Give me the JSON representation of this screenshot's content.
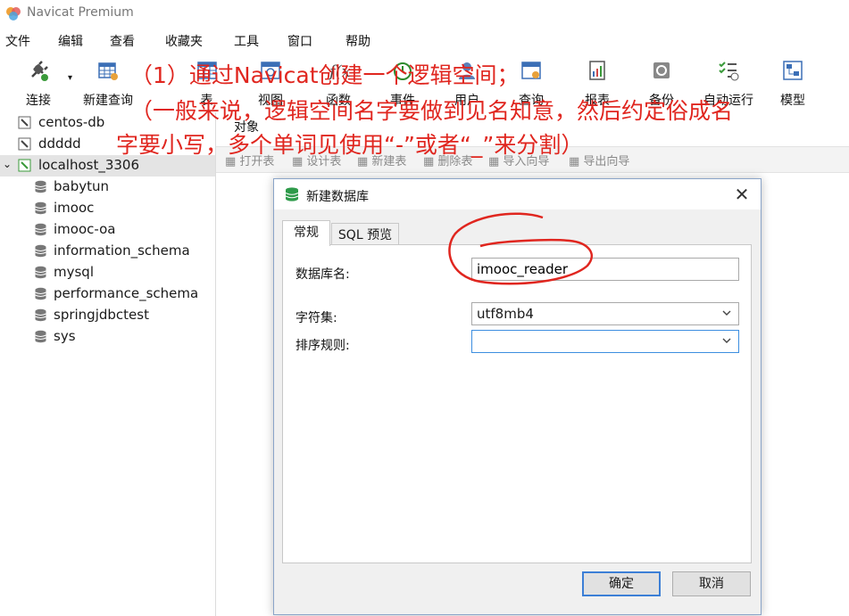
{
  "window": {
    "title": "Navicat Premium"
  },
  "menu": [
    "文件",
    "编辑",
    "查看",
    "收藏夹",
    "工具",
    "窗口",
    "帮助"
  ],
  "toolbar": {
    "items": [
      {
        "label": "连接",
        "icon": "plug-icon"
      },
      {
        "label": "新建查询",
        "icon": "table-query-icon"
      },
      {
        "label": "表",
        "icon": "table-icon"
      },
      {
        "label": "视图",
        "icon": "view-icon"
      },
      {
        "label": "函数",
        "icon": "function-icon"
      },
      {
        "label": "事件",
        "icon": "clock-icon"
      },
      {
        "label": "用户",
        "icon": "user-icon"
      },
      {
        "label": "查询",
        "icon": "query-icon"
      },
      {
        "label": "报表",
        "icon": "report-icon"
      },
      {
        "label": "备份",
        "icon": "backup-icon"
      },
      {
        "label": "自动运行",
        "icon": "checklist-icon"
      },
      {
        "label": "模型",
        "icon": "model-icon"
      }
    ]
  },
  "tree": {
    "connections": [
      "centos-db",
      "ddddd",
      "localhost_3306"
    ],
    "databases": [
      "babytun",
      "imooc",
      "imooc-oa",
      "information_schema",
      "mysql",
      "performance_schema",
      "springjdbctest",
      "sys"
    ]
  },
  "objects": {
    "tab_label": "对象",
    "buttons": [
      "打开表",
      "设计表",
      "新建表",
      "删除表",
      "导入向导",
      "导出向导"
    ]
  },
  "annotation": {
    "line1": "（1）通过Navicat创建一个逻辑空间；",
    "line2": "（一般来说，逻辑空间名字要做到见名知意，然后约定俗成名",
    "line3": "字要小写，多个单词见使用“-”或者“_”来分割）",
    "color": "#e0261f"
  },
  "dialog": {
    "title": "新建数据库",
    "tabs": [
      "常规",
      "SQL 预览"
    ],
    "db_name_label": "数据库名:",
    "db_name_value": "imooc_reader",
    "charset_label": "字符集:",
    "charset_value": "utf8mb4",
    "collation_label": "排序规则:",
    "collation_value": "",
    "ok_label": "确定",
    "cancel_label": "取消"
  }
}
